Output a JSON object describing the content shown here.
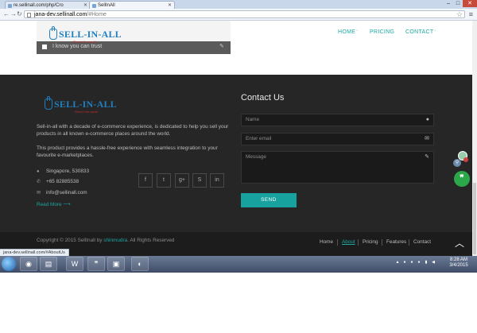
{
  "browser": {
    "tabs": [
      {
        "label": "re.sellinall.com/php/Cro",
        "active": false
      },
      {
        "label": "SellInAll",
        "active": true
      }
    ],
    "address": {
      "host": "jana-dev.sellinall.com",
      "path": "/#Home"
    },
    "window_controls": {
      "minimize": "–",
      "maximize": "□",
      "close": "✕"
    }
  },
  "site": {
    "logo_text": "SELL-IN-ALL",
    "logo_tagline": "Reach the world",
    "nav": [
      {
        "label": "HOME",
        "has_caret": true
      },
      {
        "label": "PRICING",
        "has_caret": false
      },
      {
        "label": "CONTACT",
        "has_caret": true
      }
    ],
    "form_remnant_text": "I know you can trust"
  },
  "footer": {
    "about_1": "Sell-in-all with a decade of e-commerce experience, is dedicated to help you sell your products in all known e-commerce places around the world.",
    "about_2": "This product provides a hassle-free experience with seamless integration to your favourite e-marketplaces.",
    "address": "Singapore, 530833",
    "phone": "+65 82885538",
    "email": "info@sellinall.com",
    "read_more": "Read More",
    "social": [
      {
        "icon": "facebook-icon",
        "glyph": "f"
      },
      {
        "icon": "twitter-icon",
        "glyph": "t"
      },
      {
        "icon": "google-plus-icon",
        "glyph": "g+"
      },
      {
        "icon": "skype-icon",
        "glyph": "S"
      },
      {
        "icon": "linkedin-icon",
        "glyph": "in"
      }
    ],
    "contact": {
      "title": "Contact Us",
      "name_placeholder": "Name",
      "email_placeholder": "Enter email",
      "message_placeholder": "Message",
      "send_label": "SEND"
    },
    "copyright_prefix": "Copyright © 2015 SellInall by ",
    "copyright_author": "shinmudra",
    "copyright_suffix": ". All Rights Reserved",
    "bottom_nav": [
      "Home",
      "About",
      "Pricing",
      "Features",
      "Contact"
    ],
    "active_bottom_nav": "About"
  },
  "status_url": "jana-dev.sellinall.com/#AboutUs",
  "taskbar": {
    "time": "8:28 AM",
    "date": "3/4/2015"
  },
  "colors": {
    "accent": "#1aa7a1",
    "footer_bg": "#262626",
    "logo_blue": "#1f7fbf"
  }
}
